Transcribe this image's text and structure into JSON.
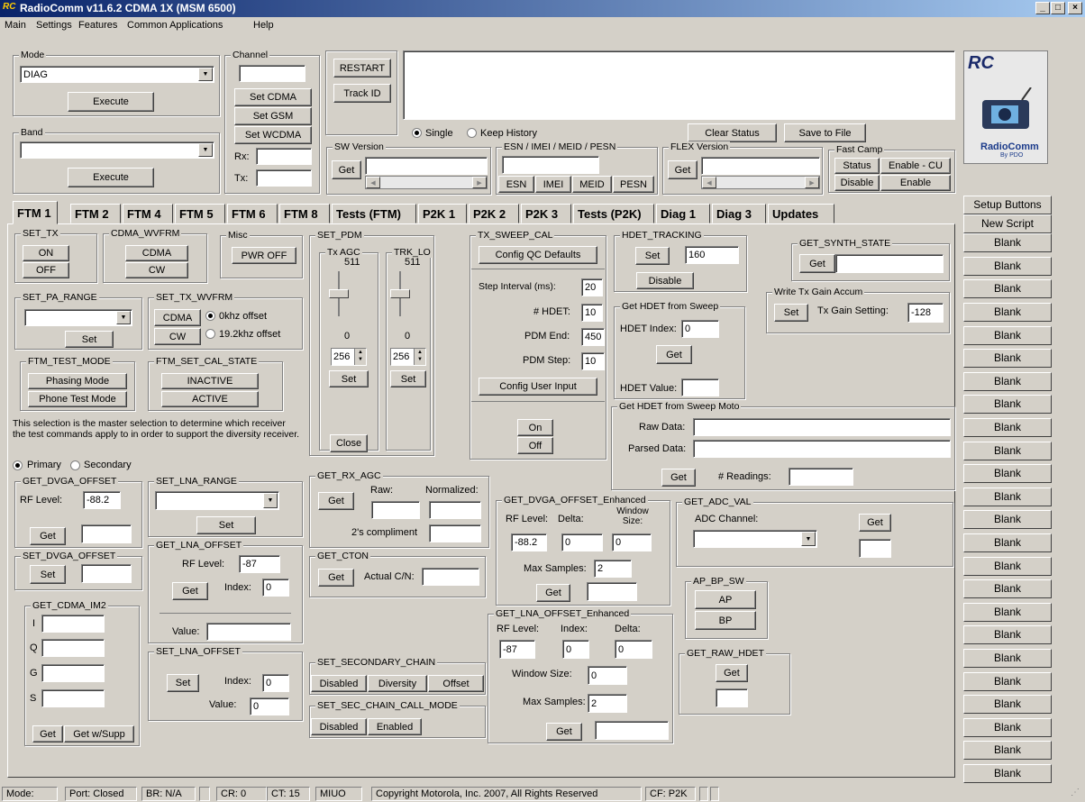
{
  "window": {
    "title": "RadioComm v11.6.2  CDMA 1X (MSM 6500)",
    "logo_text": "RC",
    "minimize": "_",
    "maximize": "□",
    "close": "×"
  },
  "menu": [
    "Main",
    "Settings",
    "Features",
    "Common Applications",
    "Help"
  ],
  "mode": {
    "legend": "Mode",
    "value": "DIAG",
    "execute": "Execute"
  },
  "band": {
    "legend": "Band",
    "value": "",
    "execute": "Execute"
  },
  "channel": {
    "legend": "Channel",
    "value": "",
    "set_cdma": "Set CDMA",
    "set_gsm": "Set GSM",
    "set_wcdma": "Set WCDMA",
    "rx_label": "Rx:",
    "rx": "",
    "tx_label": "Tx:",
    "tx": ""
  },
  "control": {
    "restart": "RESTART",
    "track_id": "Track ID",
    "single": "Single",
    "keep_history": "Keep History",
    "clear_status": "Clear Status",
    "save_to_file": "Save to File"
  },
  "sw_version": {
    "legend": "SW Version",
    "get": "Get"
  },
  "esn": {
    "legend": "ESN / IMEI / MEID / PESN",
    "buttons": [
      "ESN",
      "IMEI",
      "MEID",
      "PESN"
    ]
  },
  "flex": {
    "legend": "FLEX Version",
    "get": "Get"
  },
  "fast_camp": {
    "legend": "Fast Camp",
    "status": "Status",
    "enable_cu": "Enable - CU",
    "disable": "Disable",
    "enable": "Enable"
  },
  "brand": {
    "logo": "RC",
    "name": "RadioComm",
    "by": "By PDO"
  },
  "tabs": [
    "FTM 1",
    "FTM 2",
    "FTM 4",
    "FTM 5",
    "FTM 6",
    "FTM 8",
    "Tests (FTM)",
    "P2K 1",
    "P2K 2",
    "P2K 3",
    "Tests (P2K)",
    "Diag 1",
    "Diag 3",
    "Updates"
  ],
  "sidebar": {
    "setup": "Setup Buttons",
    "new_script": "New Script",
    "blank": "Blank"
  },
  "set_tx": {
    "legend": "SET_TX",
    "on": "ON",
    "off": "OFF"
  },
  "cdma_wvfrm": {
    "legend": "CDMA_WVFRM",
    "cdma": "CDMA",
    "cw": "CW"
  },
  "misc": {
    "legend": "Misc",
    "pwr_off": "PWR  OFF"
  },
  "set_pa_range": {
    "legend": "SET_PA_RANGE",
    "set": "Set"
  },
  "set_tx_wvfrm": {
    "legend": "SET_TX_WVFRM",
    "cdma": "CDMA",
    "cw": "CW",
    "opt1": "0khz offset",
    "opt2": "19.2khz offset"
  },
  "ftm_test_mode": {
    "legend": "FTM_TEST_MODE",
    "phasing": "Phasing Mode",
    "phone_test": "Phone Test Mode"
  },
  "ftm_set_cal_state": {
    "legend": "FTM_SET_CAL_STATE",
    "inactive": "INACTIVE",
    "active": "ACTIVE"
  },
  "diversity_note": "This selection is the master selection to determine which receiver the test commands apply to in order to support the diversity receiver.",
  "primary": "Primary",
  "secondary": "Secondary",
  "get_dvga_offset": {
    "legend": "GET_DVGA_OFFSET",
    "rf_label": "RF Level:",
    "rf": "-88.2",
    "get": "Get"
  },
  "set_dvga_offset": {
    "legend": "SET_DVGA_OFFSET",
    "set": "Set"
  },
  "get_cdma_im2": {
    "legend": "GET_CDMA_IM2",
    "i": "I",
    "q": "Q",
    "g": "G",
    "s": "S",
    "get": "Get",
    "get_w_supp": "Get w/Supp"
  },
  "set_lna_range": {
    "legend": "SET_LNA_RANGE",
    "set": "Set"
  },
  "get_lna_offset": {
    "legend": "GET_LNA_OFFSET",
    "rf_label": "RF Level:",
    "rf": "-87",
    "get": "Get",
    "index_label": "Index:",
    "index": "0",
    "value_label": "Value:"
  },
  "set_lna_offset": {
    "legend": "SET_LNA_OFFSET",
    "set": "Set",
    "index_label": "Index:",
    "index": "0",
    "value_label": "Value:",
    "value": "0"
  },
  "set_pdm": {
    "legend": "SET_PDM",
    "tx_agc": "Tx AGC",
    "trk_lo": "TRK_LO",
    "max": "511",
    "min": "0",
    "tx_value": "256",
    "trk_value": "256",
    "set": "Set",
    "close": "Close"
  },
  "get_rx_agc": {
    "legend": "GET_RX_AGC",
    "get": "Get",
    "raw": "Raw:",
    "normalized": "Normalized:",
    "twos": "2's compliment"
  },
  "get_cton": {
    "legend": "GET_CTON",
    "get": "Get",
    "actual": "Actual C/N:"
  },
  "set_secondary_chain": {
    "legend": "SET_SECONDARY_CHAIN",
    "disabled": "Disabled",
    "diversity": "Diversity",
    "offset": "Offset"
  },
  "set_sec_chain_call_mode": {
    "legend": "SET_SEC_CHAIN_CALL_MODE",
    "disabled": "Disabled",
    "enabled": "Enabled"
  },
  "tx_sweep_cal": {
    "legend": "TX_SWEEP_CAL",
    "config_defaults": "Config QC Defaults",
    "step_label": "Step Interval (ms):",
    "step": "20",
    "hdet_label": "# HDET:",
    "hdet": "10",
    "pdm_end_label": "PDM End:",
    "pdm_end": "450",
    "pdm_step_label": "PDM Step:",
    "pdm_step": "10",
    "config_user": "Config User Input",
    "on": "On",
    "off": "Off"
  },
  "hdet_tracking": {
    "legend": "HDET_TRACKING",
    "set": "Set",
    "value": "160",
    "disable": "Disable"
  },
  "get_hdet_sweep": {
    "legend": "Get HDET from Sweep",
    "index_label": "HDET Index:",
    "index": "0",
    "get": "Get",
    "value_label": "HDET Value:"
  },
  "get_hdet_sweep_moto": {
    "legend": "Get HDET from Sweep Moto",
    "raw": "Raw Data:",
    "parsed": "Parsed Data:",
    "get": "Get",
    "readings": "# Readings:"
  },
  "get_synth_state": {
    "legend": "GET_SYNTH_STATE",
    "get": "Get"
  },
  "write_tx_gain": {
    "legend": "Write Tx Gain Accum",
    "set": "Set",
    "label": "Tx Gain Setting:",
    "value": "-128"
  },
  "get_dvga_enh": {
    "legend": "GET_DVGA_OFFSET_Enhanced",
    "rf_label": "RF Level:",
    "delta_label": "Delta:",
    "window_label": "Window Size:",
    "rf": "-88.2",
    "delta": "0",
    "window": "0",
    "max_label": "Max Samples:",
    "max": "2",
    "get": "Get"
  },
  "get_lna_enh": {
    "legend": "GET_LNA_OFFSET_Enhanced",
    "rf_label": "RF Level:",
    "index_label": "Index:",
    "delta_label": "Delta:",
    "rf": "-87",
    "index": "0",
    "delta": "0",
    "window_label": "Window Size:",
    "window": "0",
    "max_label": "Max Samples:",
    "max": "2",
    "get": "Get"
  },
  "get_adc_val": {
    "legend": "GET_ADC_VAL",
    "channel_label": "ADC Channel:",
    "get": "Get"
  },
  "ap_bp_sw": {
    "legend": "AP_BP_SW",
    "ap": "AP",
    "bp": "BP"
  },
  "get_raw_hdet": {
    "legend": "GET_RAW_HDET",
    "get": "Get"
  },
  "statusbar": {
    "mode": "Mode:",
    "port": "Port: Closed",
    "br": "BR: N/A",
    "cr": "CR: 0",
    "ct": "CT: 15",
    "miuo": "MIUO",
    "copyright": "Copyright Motorola, Inc. 2007, All Rights Reserved",
    "cf": "CF: P2K"
  }
}
